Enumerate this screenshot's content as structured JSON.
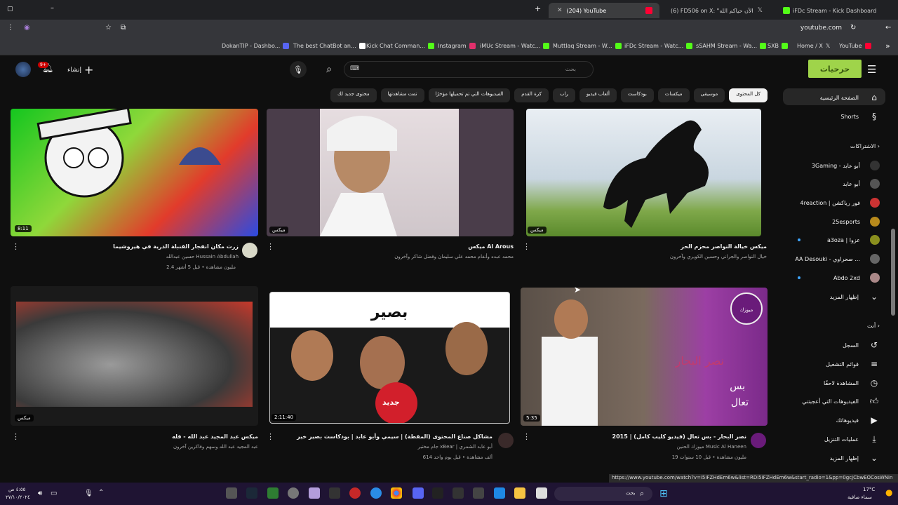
{
  "browser": {
    "tabs": [
      {
        "label": "iFDc Stream - Kick Dashboard"
      },
      {
        "label": "(6) FD506 on X: \"الآن حياكم الله"
      },
      {
        "label": "(204) YouTube"
      }
    ],
    "url": "youtube.com",
    "bookmarks": [
      "DokanTIP - Dashbo...",
      "The best ChatBot an...",
      "Kick Chat Comman...",
      "Instagram",
      "iMUc Stream - Watc...",
      "Muttlaq Stream - W...",
      "iFDc Stream - Watc...",
      "sSAHM Stream - Wa...",
      "SXB",
      "Home / X",
      "YouTube"
    ]
  },
  "header": {
    "search_placeholder": "بحث",
    "create_label": "إنشاء",
    "notif_count": "9+",
    "logo_text": "حرحيات"
  },
  "chips": [
    "كل المحتوى",
    "موسيقى",
    "ميكسات",
    "بودكاست",
    "ألعاب فيديو",
    "راب",
    "كرة القدم",
    "الفيديوهات التي تم تحميلها مؤخرًا",
    "تمت مشاهدتها",
    "محتوى جديد لك"
  ],
  "sidebar": {
    "home": "الصفحة الرئيسية",
    "shorts": "Shorts",
    "subs_head": "الاشتراكات",
    "channels": [
      "3Gaming - أبو عابد",
      "أبو عابد",
      "4reaction | فور رياكشن",
      "25esports",
      "a3oza | عزوا",
      "AA Desouki - صحراوي ...",
      "Abdo 2xd"
    ],
    "show_more": "إظهار المزيد",
    "you_head": "أنت",
    "history": "السجل",
    "playlists": "قوائم التشغيل",
    "watch_later": "المشاهدة لاحقًا",
    "liked": "الفيديوهات التي أعجبتني",
    "your_videos": "فيديوهاتك",
    "downloads": "عمليات التنزيل",
    "show_more2": "إظهار المزيد"
  },
  "videos": [
    {
      "title": "ميكس خيالة النواصر محزم الحز",
      "meta1": "خيال النواصر والجراني وحسين الكويري وآخرون",
      "meta2": "",
      "badge": "ميكس"
    },
    {
      "title": "ميكس Al Arous",
      "meta1": "محمد عبده وأنغام محمد علي سليمان وفضل شاكر وآخرون",
      "meta2": "",
      "badge": "ميكس"
    },
    {
      "title": "زرت مكان انفجار القنبلة الذرية في هيروشيما",
      "channel": "حسين عبدالله Hussain Abdullah",
      "meta2": "2.4 مليون مشاهدة • قبل 5 أشهر",
      "duration": "8:11"
    },
    {
      "title": "نصر البحار - بس تعال (فيديو كليب كامل) | 2015",
      "channel": "ميوزك الحنين Music Al Haneen",
      "meta2": "19 مليون مشاهدة • قبل 10 سنوات",
      "duration": "5:35"
    },
    {
      "title": "مشاكل صناع المحتوى (المقطة) | سيمي وأبو عابد | بودكاست بصير خير",
      "channel": "جام مختبر xBear | أبو عابد الشمري",
      "meta2": "614 ألف مشاهدة • قبل يوم واحد",
      "duration": "2:11:40",
      "new": "جديد"
    },
    {
      "title": "ميكس عبد المجيد عبد الله - قله",
      "meta1": "عبد المجيد عبد الله وسهم وفاكرين آخرون",
      "meta2": "",
      "badge": "ميكس"
    }
  ],
  "status_url": "https://www.youtube.com/watch?v=i5IFZHdEm6w&list=RDi5IFZHdEm6w&start_radio=1&pp=0gcJCbwEOCosWNin",
  "taskbar": {
    "weather": "17°C",
    "weather_desc": "سماء صافية",
    "search": "بحث",
    "time": "٤:٥٥ ص",
    "date": "٢٧/١٠/٢٠٢٤"
  }
}
